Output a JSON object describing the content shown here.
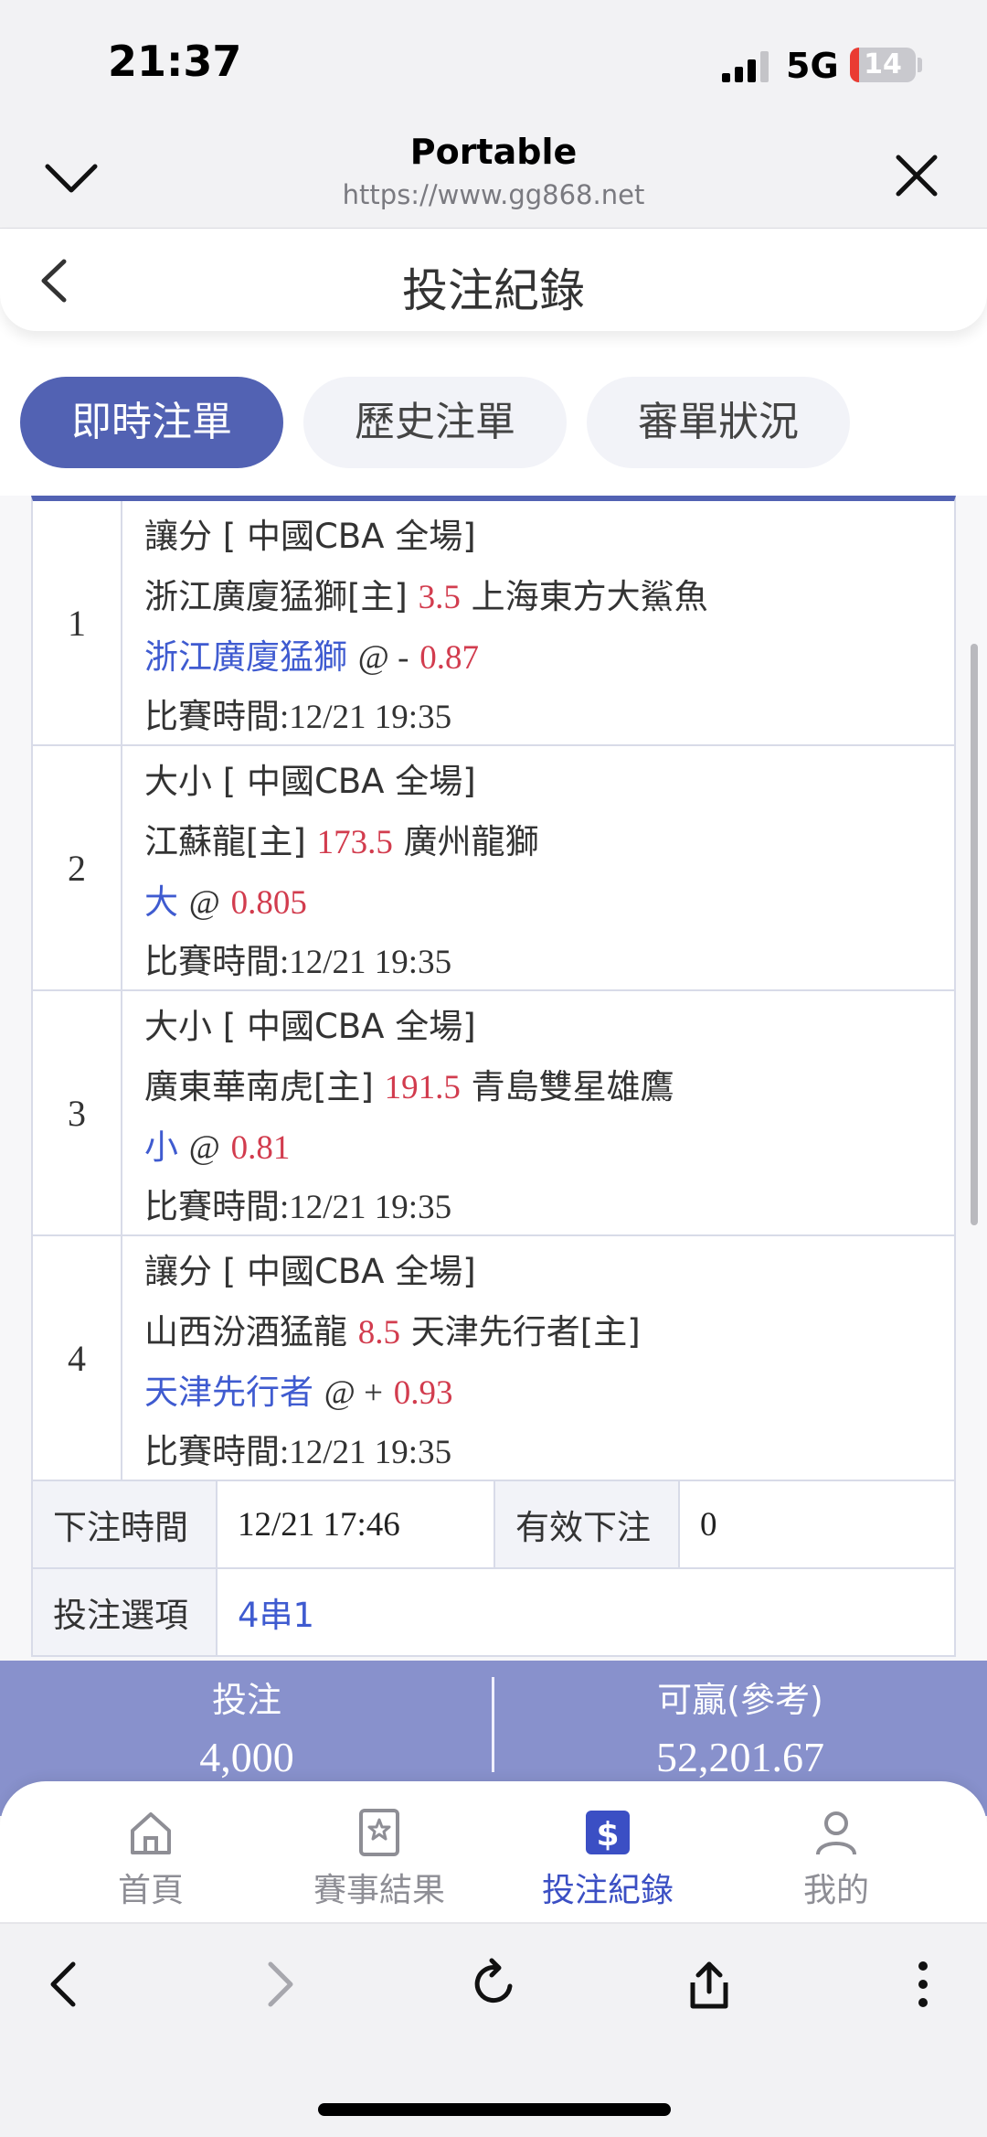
{
  "status_bar": {
    "time": "21:37",
    "network": "5G",
    "battery": "14",
    "battery_fraction": 0.14
  },
  "browser": {
    "title": "Portable",
    "url": "https://www.gg868.net"
  },
  "page": {
    "title": "投注紀錄"
  },
  "tabs": [
    {
      "label": "即時注單",
      "active": true
    },
    {
      "label": "歷史注單",
      "active": false
    },
    {
      "label": "審單狀況",
      "active": false
    }
  ],
  "legs": [
    {
      "index": "1",
      "market": "讓分 [ 中國CBA 全場]",
      "home": "浙江廣廈猛獅[主]",
      "line": "3.5",
      "away": "上海東方大鯊魚",
      "pick": "浙江廣廈猛獅",
      "at": "@ -",
      "odds": "0.87",
      "time": "比賽時間:12/21 19:35"
    },
    {
      "index": "2",
      "market": "大小 [ 中國CBA 全場]",
      "home": "江蘇龍[主]",
      "line": "173.5",
      "away": "廣州龍獅",
      "pick": "大",
      "at": "@",
      "odds": "0.805",
      "time": "比賽時間:12/21 19:35"
    },
    {
      "index": "3",
      "market": "大小 [ 中國CBA 全場]",
      "home": "廣東華南虎[主]",
      "line": "191.5",
      "away": "青島雙星雄鷹",
      "pick": "小",
      "at": "@",
      "odds": "0.81",
      "time": "比賽時間:12/21 19:35"
    },
    {
      "index": "4",
      "market": "讓分 [ 中國CBA 全場]",
      "home": "山西汾酒猛龍",
      "line": "8.5",
      "away": "天津先行者[主]",
      "pick": "天津先行者",
      "at": "@ +",
      "odds": "0.93",
      "time": "比賽時間:12/21 19:35"
    }
  ],
  "bet_info": {
    "time_label": "下注時間",
    "time_value": "12/21 17:46",
    "valid_label": "有效下注",
    "valid_value": "0",
    "option_label": "投注選項",
    "option_value": "4串1"
  },
  "summary": {
    "stake_label": "投注",
    "stake_value": "4,000",
    "win_label": "可贏(參考)",
    "win_value": "52,201.67"
  },
  "bottom_nav": [
    {
      "label": "首頁",
      "icon": "home-icon",
      "active": false
    },
    {
      "label": "賽事結果",
      "icon": "star-badge-icon",
      "active": false
    },
    {
      "label": "投注紀錄",
      "icon": "dollar-icon",
      "active": true
    },
    {
      "label": "我的",
      "icon": "person-icon",
      "active": false
    }
  ],
  "colors": {
    "accent": "#5262b3",
    "summary_bg": "#8891cc",
    "odds_red": "#d23c4e",
    "pick_blue": "#3f5bd0",
    "nav_active": "#3b4fc4"
  }
}
